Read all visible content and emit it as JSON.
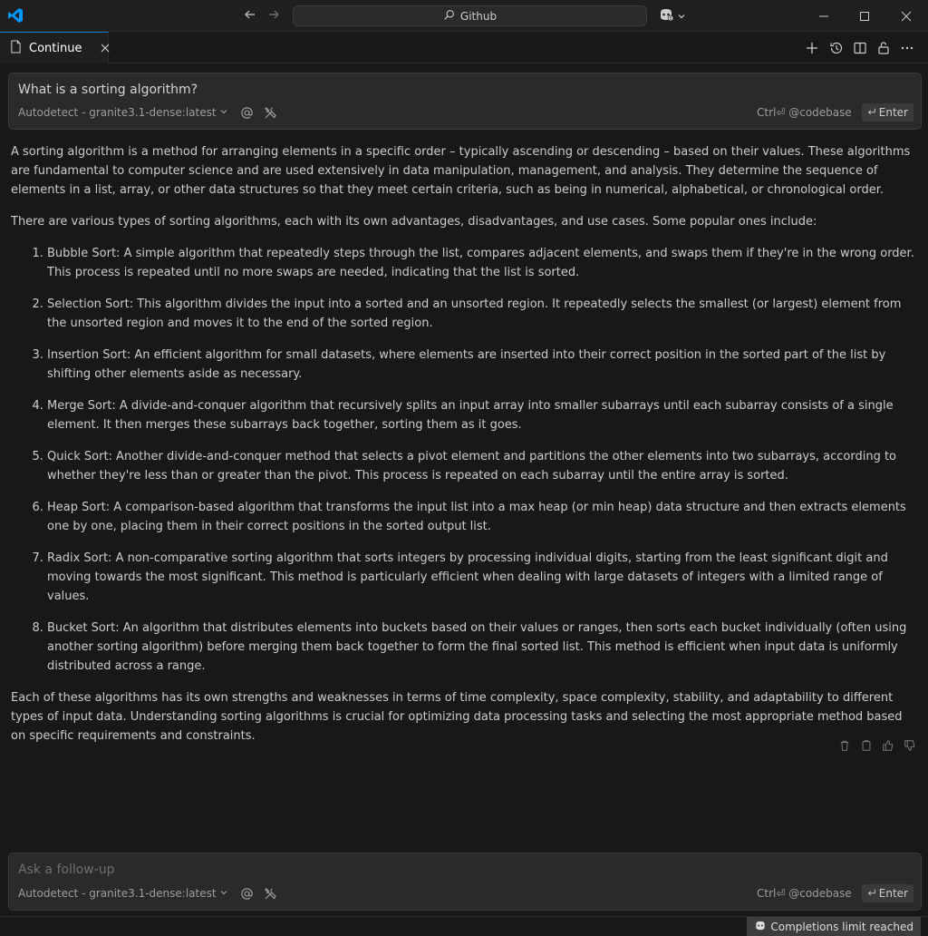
{
  "titlebar": {
    "search_text": "Github",
    "icons": [
      "vscode-logo",
      "arrow-left-icon",
      "arrow-right-icon",
      "search-icon",
      "copilot-icon",
      "minimize-icon",
      "maximize-icon",
      "close-icon"
    ]
  },
  "panel": {
    "tab_label": "Continue",
    "actions": [
      "plus-icon",
      "history-icon",
      "split-icon",
      "unlock-icon",
      "more-icon"
    ]
  },
  "top_input": {
    "text": "What is a sorting algorithm?",
    "model": "Autodetect - granite3.1-dense:latest",
    "hint": "Ctrl⏎ @codebase",
    "enter_label": "Enter"
  },
  "response": {
    "intro": "A sorting algorithm is a method for arranging elements in a specific order – typically ascending or descending – based on their values. These algorithms are fundamental to computer science and are used extensively in data manipulation, management, and analysis. They determine the sequence of elements in a list, array, or other data structures so that they meet certain criteria, such as being in numerical, alphabetical, or chronological order.",
    "lead": "There are various types of sorting algorithms, each with its own advantages, disadvantages, and use cases. Some popular ones include:",
    "items": [
      "Bubble Sort: A simple algorithm that repeatedly steps through the list, compares adjacent elements, and swaps them if they're in the wrong order. This process is repeated until no more swaps are needed, indicating that the list is sorted.",
      "Selection Sort: This algorithm divides the input into a sorted and an unsorted region. It repeatedly selects the smallest (or largest) element from the unsorted region and moves it to the end of the sorted region.",
      "Insertion Sort: An efficient algorithm for small datasets, where elements are inserted into their correct position in the sorted part of the list by shifting other elements aside as necessary.",
      "Merge Sort: A divide-and-conquer algorithm that recursively splits an input array into smaller subarrays until each subarray consists of a single element. It then merges these subarrays back together, sorting them as it goes.",
      "Quick Sort: Another divide-and-conquer method that selects a pivot element and partitions the other elements into two subarrays, according to whether they're less than or greater than the pivot. This process is repeated on each subarray until the entire array is sorted.",
      "Heap Sort: A comparison-based algorithm that transforms the input list into a max heap (or min heap) data structure and then extracts elements one by one, placing them in their correct positions in the sorted output list.",
      "Radix Sort: A non-comparative sorting algorithm that sorts integers by processing individual digits, starting from the least significant digit and moving towards the most significant. This method is particularly efficient when dealing with large datasets of integers with a limited range of values.",
      "Bucket Sort: An algorithm that distributes elements into buckets based on their values or ranges, then sorts each bucket individually (often using another sorting algorithm) before merging them back together to form the final sorted list. This method is efficient when input data is uniformly distributed across a range."
    ],
    "conclusion": "Each of these algorithms has its own strengths and weaknesses in terms of time complexity, space complexity, stability, and adaptability to different types of input data. Understanding sorting algorithms is crucial for optimizing data processing tasks and selecting the most appropriate method based on specific requirements and constraints.",
    "actions": [
      "trash-icon",
      "copy-icon",
      "thumbs-up-icon",
      "thumbs-down-icon"
    ]
  },
  "bottom_input": {
    "placeholder": "Ask a follow-up",
    "model": "Autodetect - granite3.1-dense:latest",
    "hint": "Ctrl⏎ @codebase",
    "enter_label": "Enter"
  },
  "statusbar": {
    "limit_text": "Completions limit reached"
  },
  "colors": {
    "background": "#181818",
    "titlebar": "#1f1f1f",
    "input_bg": "#2a2a2a",
    "accent": "#0078d4",
    "vscode_blue": "#0098ff"
  }
}
